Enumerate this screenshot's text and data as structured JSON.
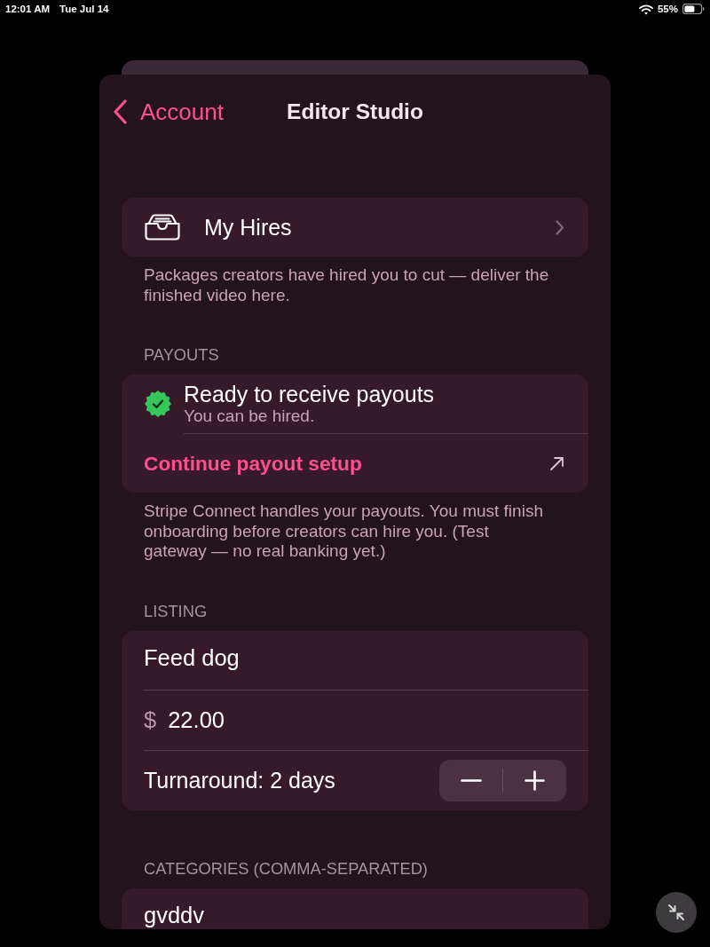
{
  "status_bar": {
    "time": "12:01 AM",
    "date": "Tue Jul 14",
    "battery": "55%"
  },
  "nav": {
    "back_label": "Account",
    "title": "Editor Studio"
  },
  "sections": [
    {
      "rows": [
        {
          "kind": "link",
          "label": "My Hires"
        }
      ],
      "footer": "Packages creators have hired you to cut — deliver the finished video here."
    },
    {
      "header": "PAYOUTS",
      "rows": [
        {
          "kind": "status",
          "title": "Ready to receive payouts",
          "subtitle": "You can be hired."
        },
        {
          "kind": "action",
          "label": "Continue payout setup"
        }
      ],
      "footer": "Stripe Connect handles your payouts. You must finish onboarding before creators can hire you. (Test gateway — no real banking yet.)"
    },
    {
      "header": "LISTING",
      "rows": [
        {
          "kind": "text_field",
          "value": "Feed dog"
        },
        {
          "kind": "currency_field",
          "symbol": "$",
          "value": "22.00"
        },
        {
          "kind": "stepper",
          "label": "Turnaround: 2 days"
        }
      ]
    },
    {
      "header": "CATEGORIES (COMMA-SEPARATED)",
      "rows": [
        {
          "kind": "text_field",
          "value": "gvddv"
        }
      ]
    }
  ]
}
